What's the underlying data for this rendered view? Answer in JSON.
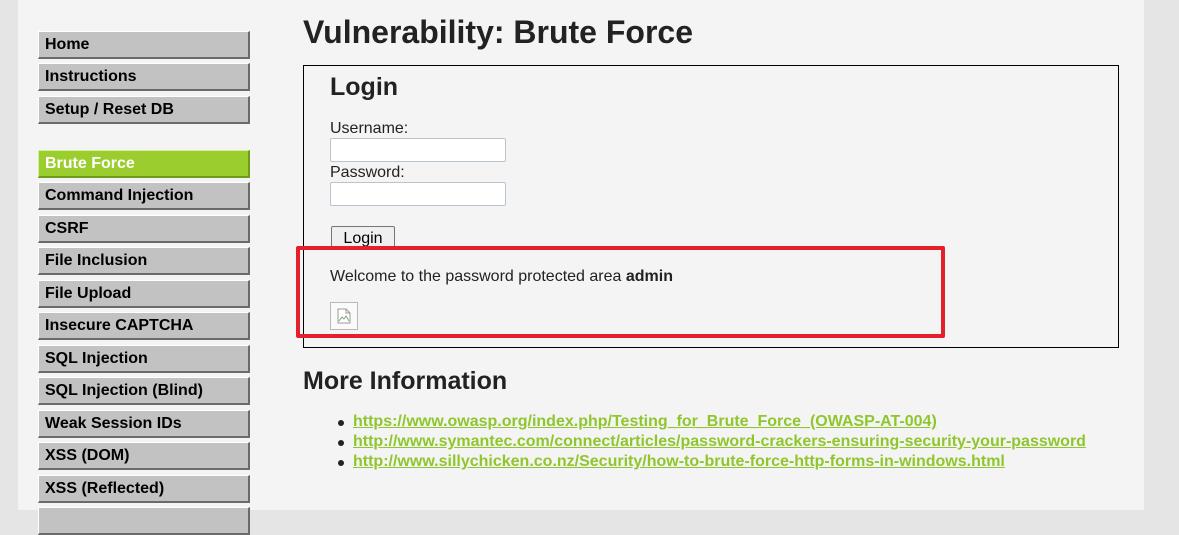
{
  "sidebar": {
    "items": [
      {
        "label": "Home"
      },
      {
        "label": "Instructions"
      },
      {
        "label": "Setup / Reset DB"
      },
      {
        "label": "Brute Force",
        "active": true
      },
      {
        "label": "Command Injection"
      },
      {
        "label": "CSRF"
      },
      {
        "label": "File Inclusion"
      },
      {
        "label": "File Upload"
      },
      {
        "label": "Insecure CAPTCHA"
      },
      {
        "label": "SQL Injection"
      },
      {
        "label": "SQL Injection (Blind)"
      },
      {
        "label": "Weak Session IDs"
      },
      {
        "label": "XSS (DOM)"
      },
      {
        "label": "XSS (Reflected)"
      }
    ]
  },
  "main": {
    "title": "Vulnerability: Brute Force",
    "login": {
      "heading": "Login",
      "username_label": "Username:",
      "username_value": "",
      "password_label": "Password:",
      "password_value": "",
      "button_label": "Login",
      "welcome_text": "Welcome to the password protected area ",
      "welcome_user": "admin",
      "image_icon": "broken-image-icon"
    },
    "more_info": {
      "heading": "More Information",
      "links": [
        "https://www.owasp.org/index.php/Testing_for_Brute_Force_(OWASP-AT-004)",
        "http://www.symantec.com/connect/articles/password-crackers-ensuring-security-your-password",
        "http://www.sillychicken.co.nz/Security/how-to-brute-force-http-forms-in-windows.html"
      ]
    }
  },
  "colors": {
    "accent_green": "#9ccd2e",
    "link_green": "#8fc62d",
    "highlight_red": "#e4202a"
  }
}
